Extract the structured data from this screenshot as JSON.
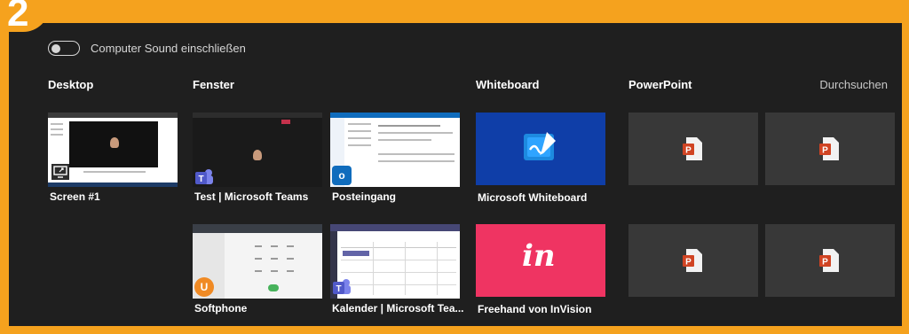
{
  "step_badge": "2",
  "toggle": {
    "label": "Computer Sound einschließen",
    "state": "off"
  },
  "sections": {
    "desktop": "Desktop",
    "window": "Fenster",
    "whiteboard": "Whiteboard",
    "powerpoint": "PowerPoint",
    "browse": "Durchsuchen"
  },
  "tiles": {
    "screen1": "Screen #1",
    "teams_test": "Test | Microsoft Teams",
    "inbox": "Posteingang",
    "ms_whiteboard": "Microsoft Whiteboard",
    "softphone": "Softphone",
    "calendar": "Kalender | Microsoft Tea...",
    "freehand": "Freehand von InVision"
  },
  "icons": {
    "invision_mark": "in",
    "ppt_letter": "P",
    "outlook_letter": "o",
    "softphone_letter": "U"
  },
  "colors": {
    "frame": "#f5a21e",
    "panel": "#1f1f1f",
    "whiteboard_tile": "#0f3ea8",
    "invision_tile": "#ef3462",
    "ppt_tile": "#383838"
  }
}
